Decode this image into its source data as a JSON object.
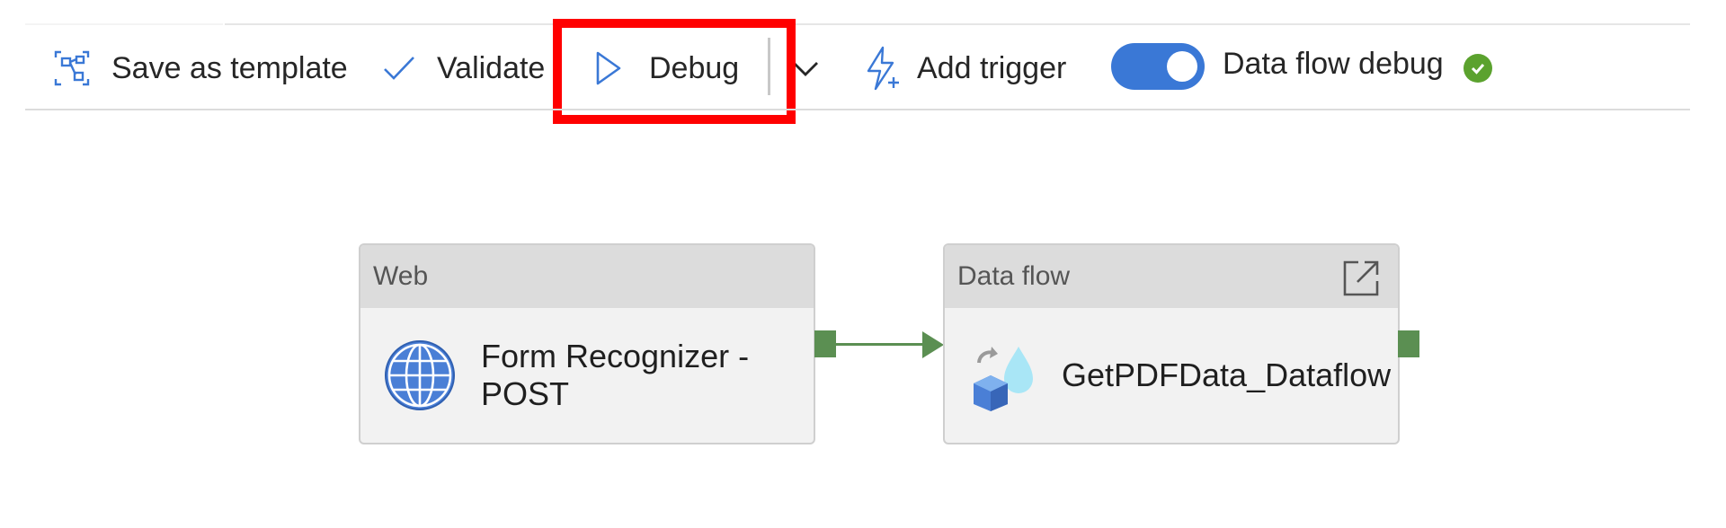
{
  "toolbar": {
    "save_template_label": "Save as template",
    "validate_label": "Validate",
    "debug_label": "Debug",
    "debug_dropdown_icon": "chevron-down-icon",
    "add_trigger_label": "Add trigger",
    "dataflow_debug_label": "Data flow debug",
    "dataflow_debug_on": true,
    "dataflow_debug_status": "check-circle-icon"
  },
  "canvas": {
    "activities": [
      {
        "type": "Web",
        "name_line1": "Form Recognizer -",
        "name_line2": "POST",
        "icon": "globe-icon"
      },
      {
        "type": "Data flow",
        "name": "GetPDFData_Dataflow",
        "icon": "dataflow-icon",
        "header_action_icon": "open-external-icon"
      }
    ]
  },
  "colors": {
    "accent_blue": "#3a78d6",
    "success_green": "#5ba22e",
    "connector_green": "#5b8f52",
    "highlight_red": "#ff0000"
  }
}
